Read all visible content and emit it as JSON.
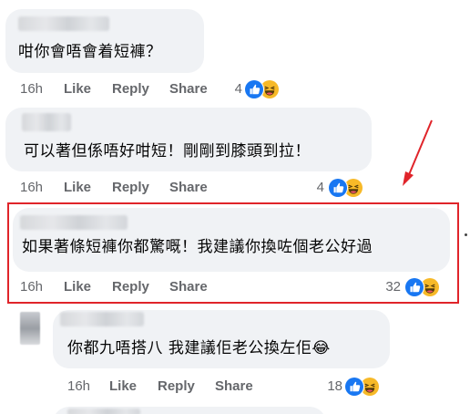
{
  "comments": [
    {
      "text": "咁你會唔會着短褲？",
      "time": "16h",
      "like": "Like",
      "reply": "Reply",
      "share": "Share",
      "reaction_count": "4",
      "reactions": [
        "like-icon",
        "haha-icon"
      ]
    },
    {
      "text": "可以著但係唔好咁短！剛剛到膝頭到拉！",
      "time": "16h",
      "like": "Like",
      "reply": "Reply",
      "share": "Share",
      "reaction_count": "4",
      "reactions": [
        "like-icon",
        "haha-icon"
      ]
    },
    {
      "text": "如果著條短褲你都驚嘅！我建議你換咗個老公好過",
      "time": "16h",
      "like": "Like",
      "reply": "Reply",
      "share": "Share",
      "reaction_count": "32",
      "reactions": [
        "like-icon",
        "haha-icon"
      ],
      "highlighted": true
    },
    {
      "text": "你都九唔搭八 我建議佢老公換左佢😂",
      "time": "16h",
      "like": "Like",
      "reply": "Reply",
      "share": "Share",
      "reaction_count": "18",
      "reactions": [
        "like-icon",
        "haha-icon"
      ]
    }
  ],
  "colors": {
    "bubble": "#f0f2f5",
    "meta_text": "#65676b",
    "like_blue": "#1877f2",
    "haha_yellow": "#f7b928",
    "highlight_red": "#e0242a"
  }
}
